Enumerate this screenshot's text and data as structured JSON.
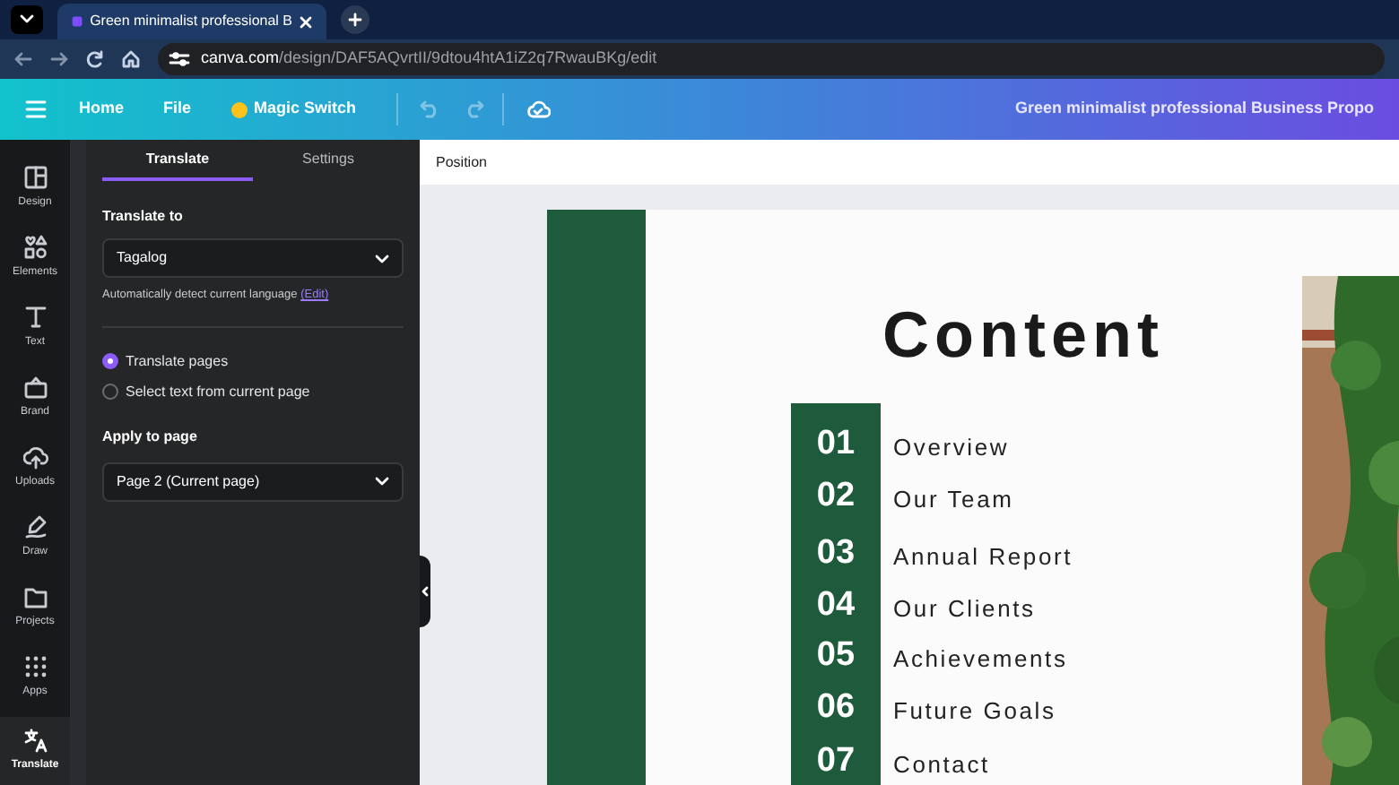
{
  "browser": {
    "tab_title": "Green minimalist professional B",
    "url_host": "canva.com",
    "url_path": "/design/DAF5AQvrtII/9dtou4htA1iZ2q7RwauBKg/edit"
  },
  "toolbar": {
    "items": [
      "Home",
      "File",
      "Magic Switch"
    ],
    "document_title": "Green minimalist professional Business Propo"
  },
  "rail": [
    {
      "label": "Design",
      "selected": false
    },
    {
      "label": "Elements",
      "selected": false
    },
    {
      "label": "Text",
      "selected": false
    },
    {
      "label": "Brand",
      "selected": false
    },
    {
      "label": "Uploads",
      "selected": false
    },
    {
      "label": "Draw",
      "selected": false
    },
    {
      "label": "Projects",
      "selected": false
    },
    {
      "label": "Apps",
      "selected": false
    },
    {
      "label": "Translate",
      "selected": true
    }
  ],
  "panel": {
    "tabs": [
      {
        "label": "Translate",
        "selected": true
      },
      {
        "label": "Settings",
        "selected": false
      }
    ],
    "translate_to_label": "Translate to",
    "language": "Tagalog",
    "detect_note": "Automatically detect current language",
    "edit_link": "(Edit)",
    "modes": [
      {
        "label": "Translate pages",
        "selected": true
      },
      {
        "label": "Select text from current page",
        "selected": false
      }
    ],
    "apply_label": "Apply to page",
    "page": "Page 2 (Current page)"
  },
  "canvas": {
    "context_bar": "Position",
    "slide": {
      "title": "Content",
      "items": [
        {
          "number": "01",
          "label": "Overview"
        },
        {
          "number": "02",
          "label": "Our Team"
        },
        {
          "number": "03",
          "label": "Annual Report"
        },
        {
          "number": "04",
          "label": "Our Clients"
        },
        {
          "number": "05",
          "label": "Achievements"
        },
        {
          "number": "06",
          "label": "Future Goals"
        },
        {
          "number": "07",
          "label": "Contact"
        }
      ]
    }
  }
}
